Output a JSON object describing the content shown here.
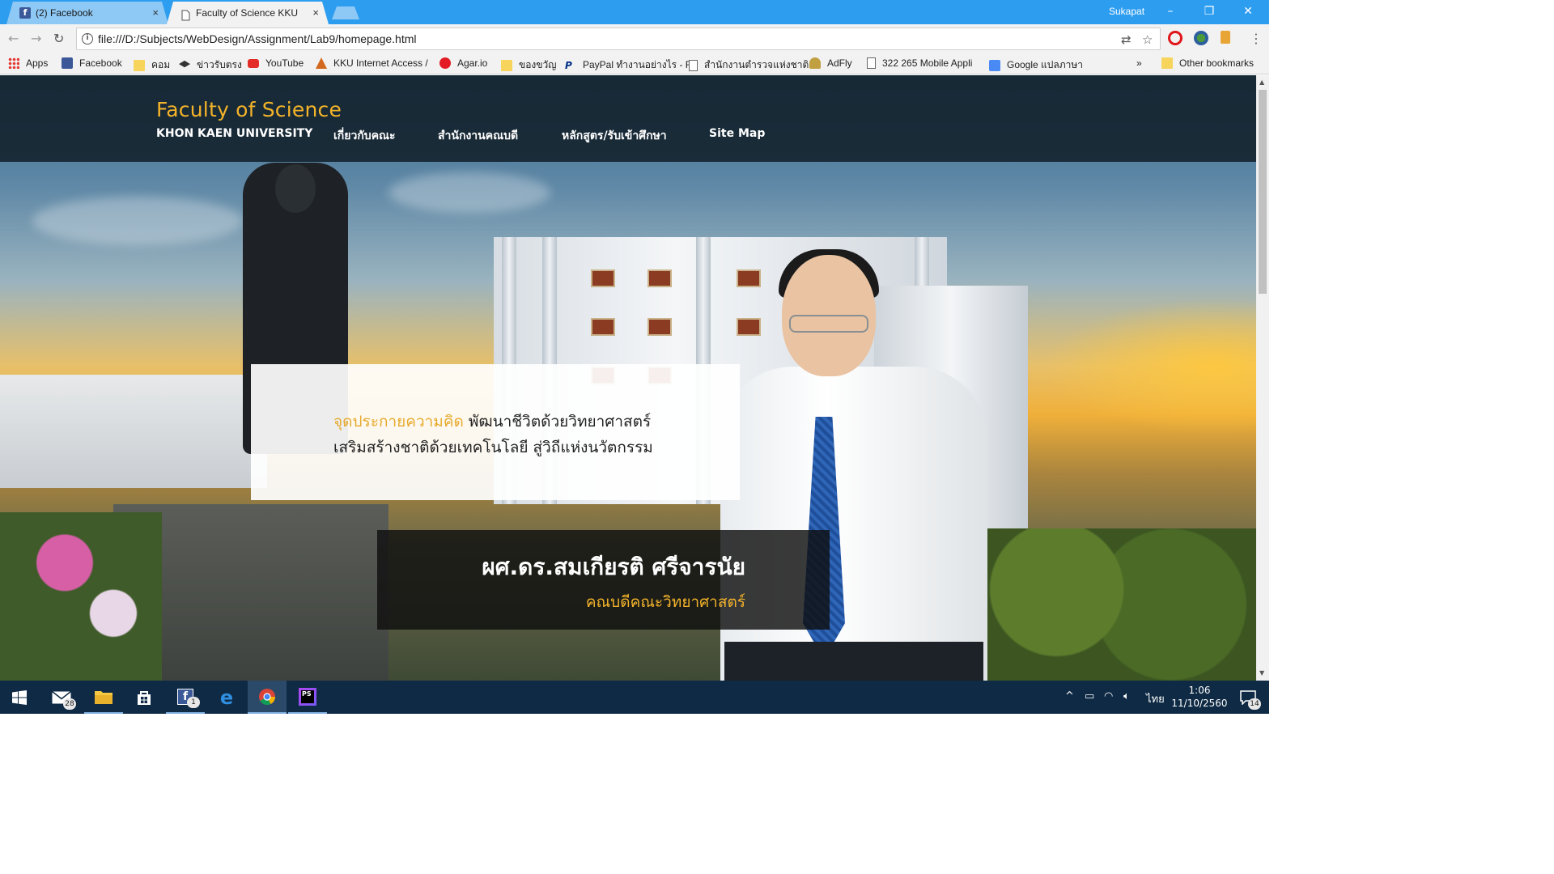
{
  "browser": {
    "tabs": [
      {
        "title": "(2) Facebook",
        "favicon": "facebook-icon",
        "active": false
      },
      {
        "title": "Faculty of Science KKU",
        "favicon": "page-icon",
        "active": true
      }
    ],
    "user": "Sukapat",
    "url": "file:///D:/Subjects/WebDesign/Assignment/Lab9/homepage.html",
    "bookmarks": [
      {
        "label": "Apps",
        "icon": "apps-grid-icon"
      },
      {
        "label": "Facebook",
        "icon": "facebook-icon"
      },
      {
        "label": "คอม",
        "icon": "folder-icon"
      },
      {
        "label": "ข่าวรับตรง",
        "icon": "graduation-cap-icon"
      },
      {
        "label": "YouTube",
        "icon": "youtube-icon"
      },
      {
        "label": "KKU Internet Access /",
        "icon": "kku-icon"
      },
      {
        "label": "Agar.io",
        "icon": "agar-icon"
      },
      {
        "label": "ของขวัญ",
        "icon": "folder-icon"
      },
      {
        "label": "PayPal ทำงานอย่างไร - F",
        "icon": "paypal-icon"
      },
      {
        "label": "สำนักงานตำรวจแห่งชาติ",
        "icon": "page-icon"
      },
      {
        "label": "AdFly",
        "icon": "adfly-icon"
      },
      {
        "label": "322 265 Mobile Appli",
        "icon": "page-icon"
      },
      {
        "label": "Google แปลภาษา",
        "icon": "google-translate-icon"
      }
    ],
    "more_bookmarks": "»",
    "other_bookmarks": "Other bookmarks"
  },
  "site": {
    "brand_title": "Faculty of Science",
    "brand_sub": "KHON KAEN UNIVERSITY",
    "nav": [
      "เกี่ยวกับคณะ",
      "สำนักงานคณบดี",
      "หลักสูตร/รับเข้าศึกษา",
      "Site Map"
    ],
    "quote": {
      "accent": "จุดประกายความคิด",
      "line1_rest": " พัฒนาชีวิตด้วยวิทยาศาสตร์",
      "line2": "เสริมสร้างชาติด้วยเทคโนโลยี สู่วิถีแห่งนวัตกรรม"
    },
    "dean": {
      "name": "ผศ.ดร.สมเกียรติ ศรีจารนัย",
      "role": "คณบดีคณะวิทยาศาสตร์"
    }
  },
  "taskbar": {
    "items": [
      {
        "name": "start-button",
        "icon": "windows-logo-icon"
      },
      {
        "name": "mail-app",
        "icon": "mail-icon",
        "badge": "28"
      },
      {
        "name": "file-explorer",
        "icon": "folder-icon"
      },
      {
        "name": "store-app",
        "icon": "store-icon"
      },
      {
        "name": "facebook-app",
        "icon": "facebook-icon",
        "badge": "1"
      },
      {
        "name": "edge-browser",
        "icon": "edge-icon"
      },
      {
        "name": "chrome-browser",
        "icon": "chrome-icon"
      },
      {
        "name": "phpstorm-app",
        "icon": "phpstorm-icon"
      }
    ],
    "language": "ไทย",
    "time": "1:06",
    "date": "11/10/2560",
    "notifications": "14"
  },
  "colors": {
    "chrome_blue": "#2d9df0",
    "header_bg": "#12202a",
    "accent_gold": "#f3b32a",
    "taskbar": "#0f2a44"
  }
}
